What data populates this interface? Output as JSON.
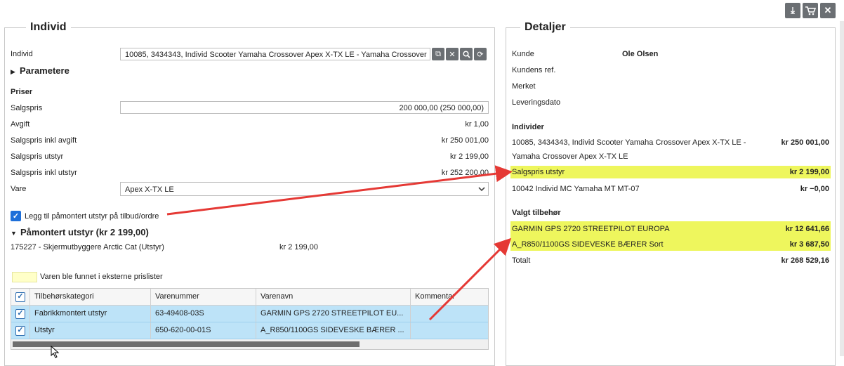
{
  "toolbar": {
    "icons": [
      "download-icon",
      "cart-icon",
      "close-icon"
    ]
  },
  "individ_panel": {
    "title": "Individ",
    "individ_label": "Individ",
    "individ_value": "10085, 3434343, Individ Scooter Yamaha Crossover Apex X-TX LE - Yamaha Crossover",
    "parametere_label": "Parametere",
    "priser_heading": "Priser",
    "salgspris_label": "Salgspris",
    "salgspris_value": "200 000,00 (250 000,00)",
    "avgift_label": "Avgift",
    "avgift_value": "kr 1,00",
    "salgspris_inkl_avgift_label": "Salgspris inkl avgift",
    "salgspris_inkl_avgift_value": "kr 250 001,00",
    "salgspris_utstyr_label": "Salgspris utstyr",
    "salgspris_utstyr_value": "kr 2 199,00",
    "salgspris_inkl_utstyr_label": "Salgspris inkl utstyr",
    "salgspris_inkl_utstyr_value": "kr 252 200,00",
    "vare_label": "Vare",
    "vare_value": "Apex X-TX LE",
    "checkbox_label": "Legg til påmontert utstyr på tilbud/ordre",
    "pamontert_heading": "Påmontert utstyr (kr 2 199,00)",
    "pamontert_item_name": "175227 - Skjermutbyggere Arctic Cat (Utstyr)",
    "pamontert_item_price": "kr 2 199,00",
    "legend_text": "Varen ble funnet i eksterne prislister",
    "grid": {
      "headers": [
        "Tilbehørskategori",
        "Varenummer",
        "Varenavn",
        "Kommentar"
      ],
      "rows": [
        {
          "kategori": "Fabrikkmontert utstyr",
          "varenummer": "63-49408-03S",
          "varenavn": "GARMIN GPS 2720 STREETPILOT EU...",
          "kommentar": ""
        },
        {
          "kategori": "Utstyr",
          "varenummer": "650-620-00-01S",
          "varenavn": "A_R850/1100GS SIDEVESKE BÆRER ...",
          "kommentar": ""
        }
      ]
    }
  },
  "detaljer_panel": {
    "title": "Detaljer",
    "kunde_label": "Kunde",
    "kunde_value": "Ole Olsen",
    "kundens_ref_label": "Kundens ref.",
    "merket_label": "Merket",
    "leveringsdato_label": "Leveringsdato",
    "individer_heading": "Individer",
    "individ_line1": "10085, 3434343, Individ Scooter Yamaha Crossover Apex X-TX LE -",
    "individ_line2": "Yamaha Crossover Apex X-TX LE",
    "individ_price": "kr 250 001,00",
    "salgspris_utstyr_label": "Salgspris utstyr",
    "salgspris_utstyr_value": "kr 2 199,00",
    "mc_label": "10042 Individ MC Yamaha MT MT-07",
    "mc_value": "kr −0,00",
    "valgt_heading": "Valgt tilbehør",
    "garmin_label": "GARMIN GPS 2720 STREETPILOT EUROPA",
    "garmin_value": "kr 12 641,66",
    "sideveske_label": "A_R850/1100GS SIDEVESKE BÆRER Sort",
    "sideveske_value": "kr 3 687,50",
    "totalt_label": "Totalt",
    "totalt_value": "kr 268 529,16"
  },
  "colors": {
    "highlight": "#eef65d",
    "arrow": "#e53935",
    "selected_row": "#bde3f8",
    "legend_swatch": "#ffffc8"
  }
}
